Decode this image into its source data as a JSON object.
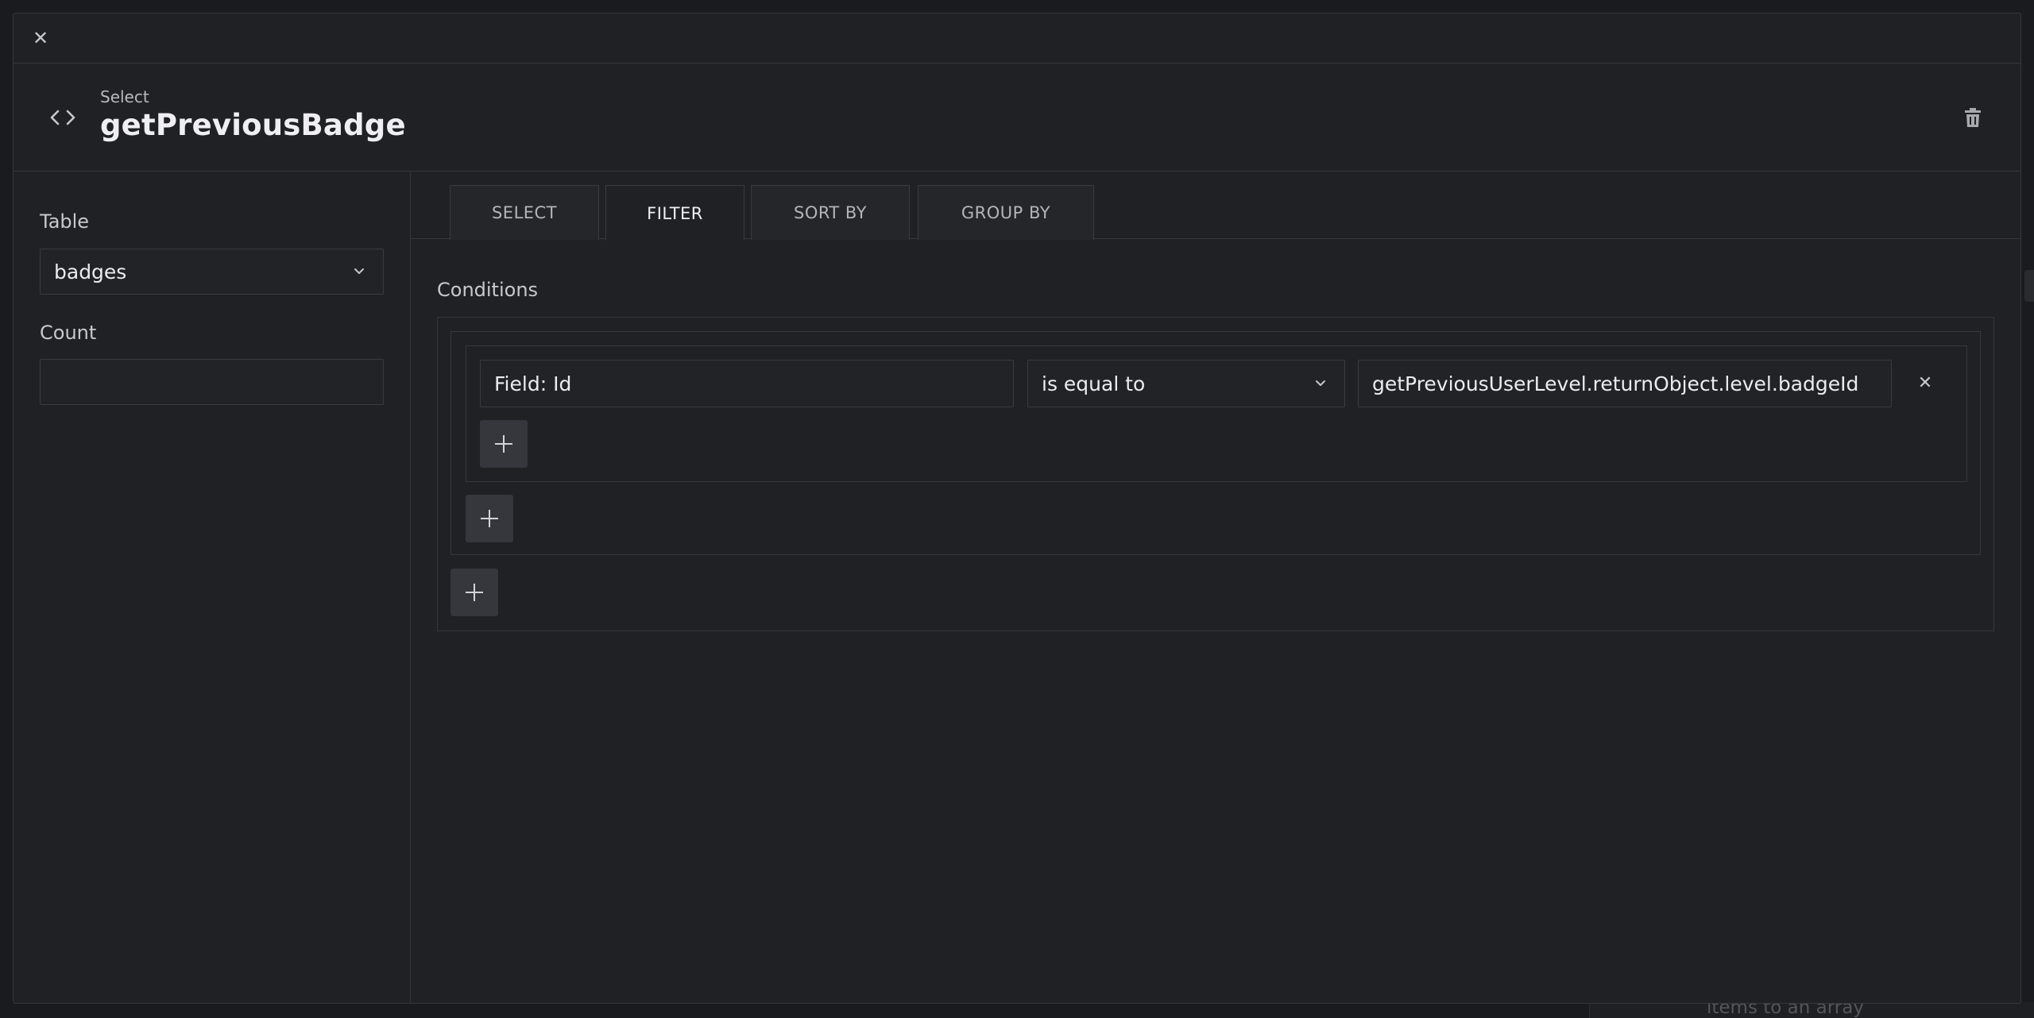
{
  "background": {
    "peek_text": "items to an array"
  },
  "topbar": {
    "close_icon": "close-icon"
  },
  "header": {
    "icon": "code-brackets-icon",
    "subtitle": "Select",
    "title": "getPreviousBadge",
    "delete_icon": "trash-icon"
  },
  "left_panel": {
    "table_label": "Table",
    "table_value": "badges",
    "count_label": "Count",
    "count_value": ""
  },
  "tabs": [
    {
      "label": "SELECT",
      "active": false
    },
    {
      "label": "FILTER",
      "active": true
    },
    {
      "label": "SORT BY",
      "active": false
    },
    {
      "label": "GROUP BY",
      "active": false
    }
  ],
  "filter": {
    "conditions_label": "Conditions",
    "condition": {
      "field": "Field: Id",
      "operator": "is equal to",
      "value": "getPreviousUserLevel.returnObject.level.badgeId"
    }
  },
  "colors": {
    "page_bg": "#1a1b1e",
    "panel_bg": "#202125",
    "border": "#36373c",
    "button_bg": "#36373c",
    "text": "#ececee",
    "muted_text": "#b4b4ba"
  }
}
